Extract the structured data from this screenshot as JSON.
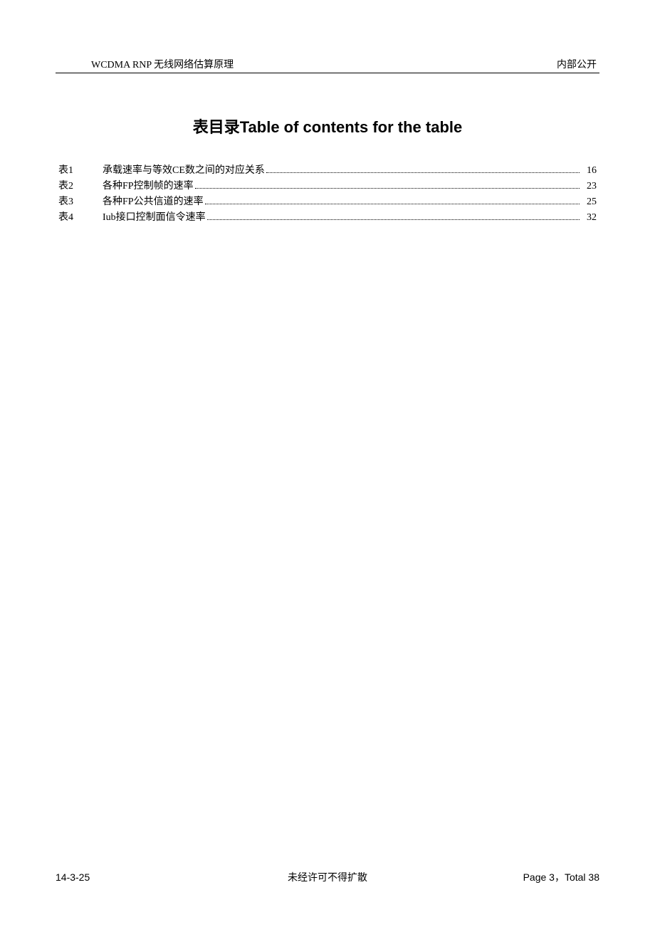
{
  "header": {
    "left": "WCDMA RNP  无线网络估算原理",
    "right": "内部公开"
  },
  "title": "表目录Table of contents for the table",
  "toc": [
    {
      "label": "表1",
      "title": "承载速率与等效CE数之间的对应关系",
      "page": "16"
    },
    {
      "label": "表2",
      "title": "各种FP控制帧的速率",
      "page": "23"
    },
    {
      "label": "表3",
      "title": "各种FP公共信道的速率",
      "page": "25"
    },
    {
      "label": "表4",
      "title": "Iub接口控制面信令速率",
      "page": "32"
    }
  ],
  "footer": {
    "left": "14-3-25",
    "center": "未经许可不得扩散",
    "right": "Page 3，Total 38"
  }
}
